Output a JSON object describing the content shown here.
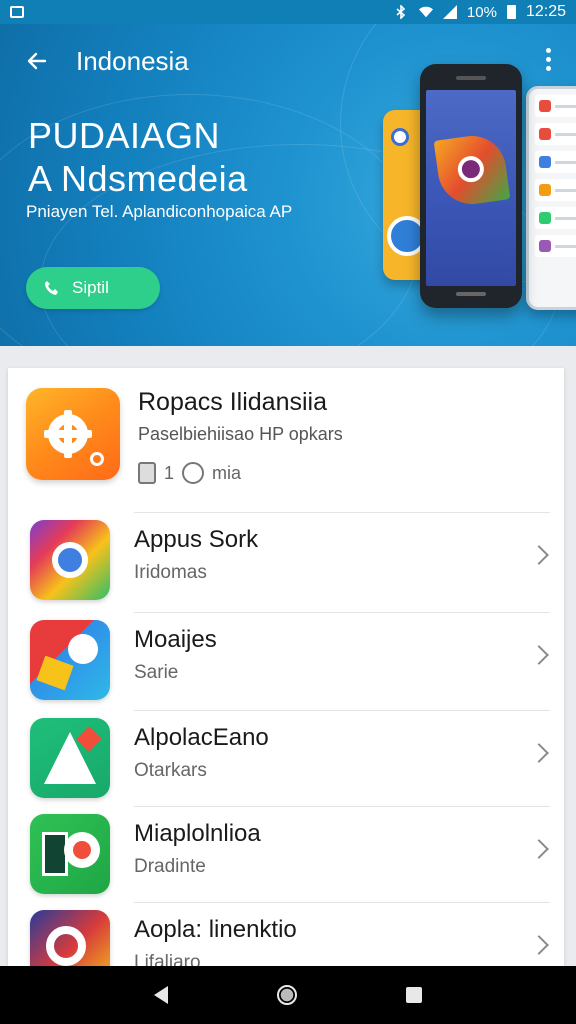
{
  "status_bar": {
    "battery": "10%",
    "time": "12:25"
  },
  "app_bar": {
    "title": "Indonesia",
    "back_icon": "arrow-left-icon",
    "more_icon": "more-vert-icon"
  },
  "hero": {
    "title_line1": "PUDAIAGN",
    "title_line2": "A Ndsmedeia",
    "subtitle": "Pniayen Tel. Aplandiconhopaica AP",
    "cta_label": "Siptil",
    "cta_icon": "phone-icon",
    "colors": {
      "background": "#1a8ccb",
      "cta": "#2ecf8a"
    }
  },
  "featured": {
    "title": "Ropacs Ilidansiia",
    "subtitle": "Paselbiehiisao HP opkars",
    "meta_count": "1",
    "meta_text": "mia",
    "icon": "gear-icon"
  },
  "apps": [
    {
      "title": "Appus Sork",
      "subtitle": "Iridomas",
      "icon": "colorful-lens-icon"
    },
    {
      "title": "Moaijes",
      "subtitle": "Sarie",
      "icon": "map-pin-icon"
    },
    {
      "title": "AlpolacEano",
      "subtitle": "Otarkars",
      "icon": "letter-a-icon"
    },
    {
      "title": "Miaplolnlioa",
      "subtitle": "Dradinte",
      "icon": "chart-icon"
    },
    {
      "title": "Aopla: linenktio",
      "subtitle": "Lifaliaro",
      "icon": "ring-icon"
    }
  ],
  "nav": {
    "back_icon": "nav-back-icon",
    "home_icon": "nav-home-icon",
    "recent_icon": "nav-recent-icon"
  }
}
